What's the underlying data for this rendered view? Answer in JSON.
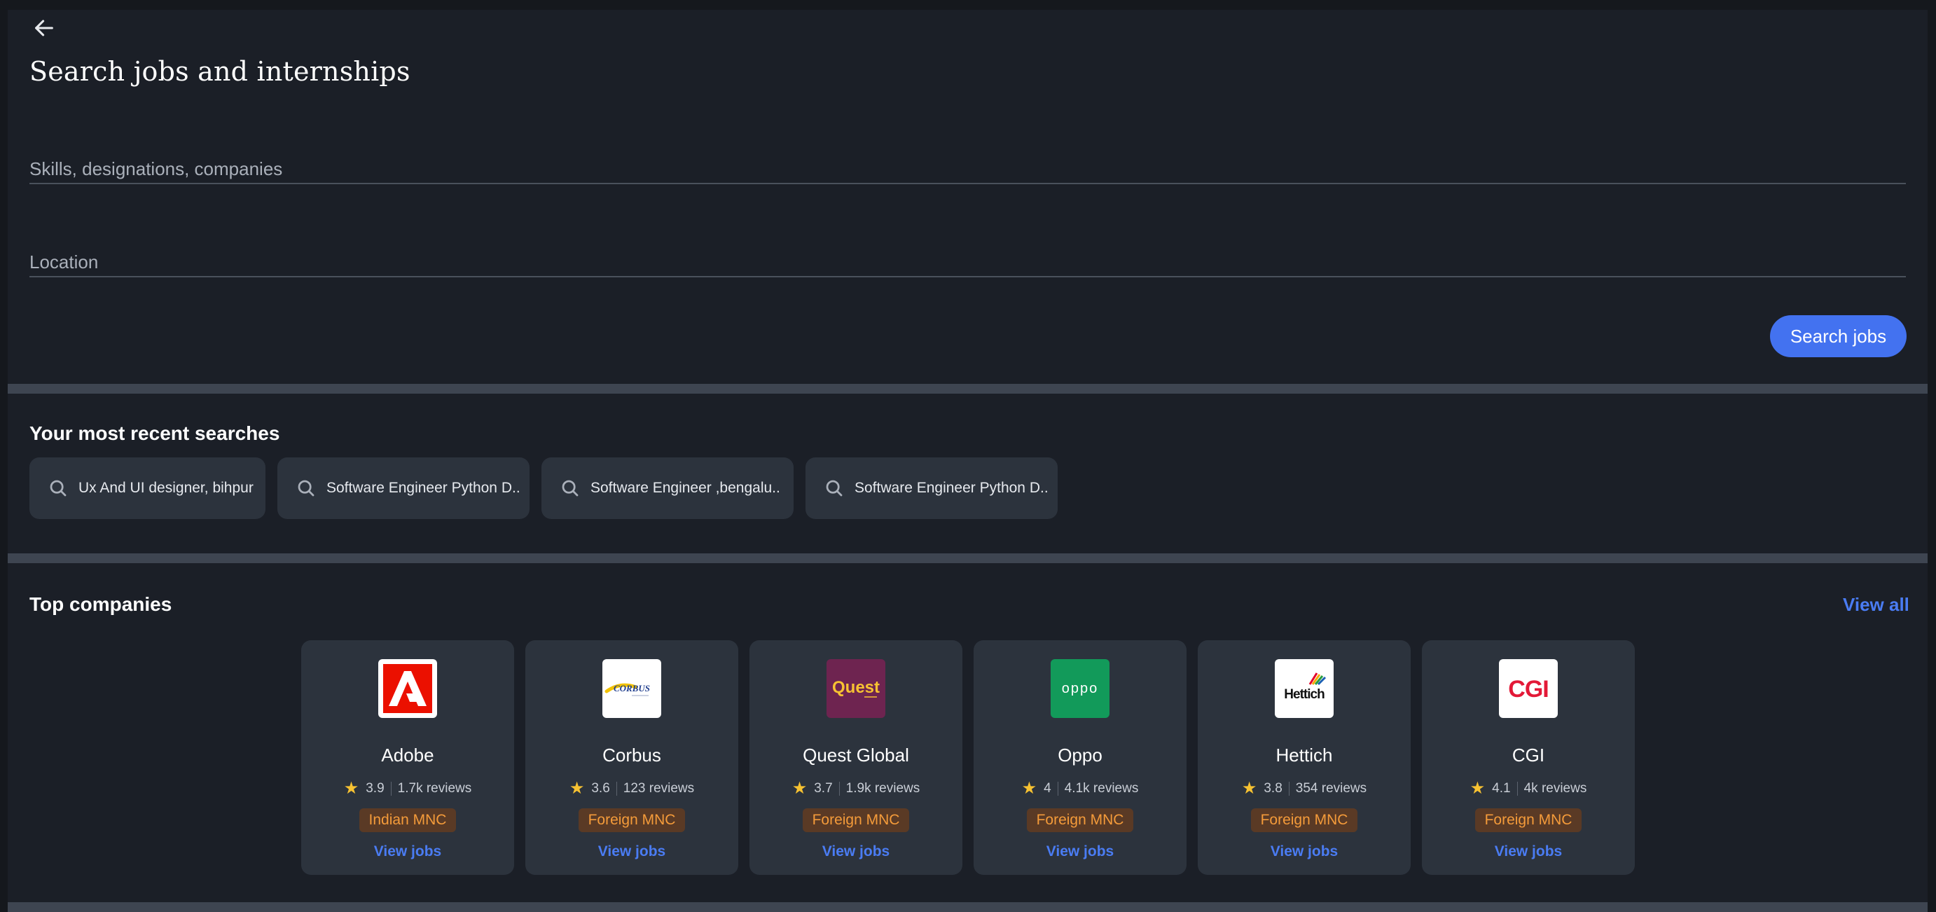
{
  "header": {
    "title": "Search jobs and internships"
  },
  "search": {
    "skills_placeholder": "Skills, designations, companies",
    "location_placeholder": "Location",
    "button_label": "Search jobs"
  },
  "recent": {
    "title": "Your most recent searches",
    "items": [
      "Ux And UI designer, bihpur",
      "Software Engineer Python D..",
      "Software Engineer ,bengalu..",
      "Software Engineer Python D.."
    ]
  },
  "companies": {
    "title": "Top companies",
    "view_all": "View all",
    "view_jobs_label": "View jobs",
    "items": [
      {
        "name": "Adobe",
        "rating": "3.9",
        "reviews": "1.7k reviews",
        "type": "Indian MNC",
        "logo_text": "",
        "logo_color": "#ffffff"
      },
      {
        "name": "Corbus",
        "rating": "3.6",
        "reviews": "123 reviews",
        "type": "Foreign MNC",
        "logo_text": "CORBUS",
        "logo_color": "#ffffff"
      },
      {
        "name": "Quest Global",
        "rating": "3.7",
        "reviews": "1.9k reviews",
        "type": "Foreign MNC",
        "logo_text": "Quest",
        "logo_color": "#6e2450"
      },
      {
        "name": "Oppo",
        "rating": "4",
        "reviews": "4.1k reviews",
        "type": "Foreign MNC",
        "logo_text": "oppo",
        "logo_color": "#129a5a"
      },
      {
        "name": "Hettich",
        "rating": "3.8",
        "reviews": "354 reviews",
        "type": "Foreign MNC",
        "logo_text": "Hettich",
        "logo_color": "#ffffff"
      },
      {
        "name": "CGI",
        "rating": "4.1",
        "reviews": "4k reviews",
        "type": "Foreign MNC",
        "logo_text": "CGI",
        "logo_color": "#ffffff"
      }
    ]
  },
  "colors": {
    "accent": "#4372f0",
    "badge_text": "#f49b3a",
    "star": "#f7c232",
    "background": "#1b1f27",
    "card": "#2c333d"
  },
  "icons": {
    "back": "arrow-left-icon",
    "search": "search-icon",
    "star": "star-icon"
  }
}
